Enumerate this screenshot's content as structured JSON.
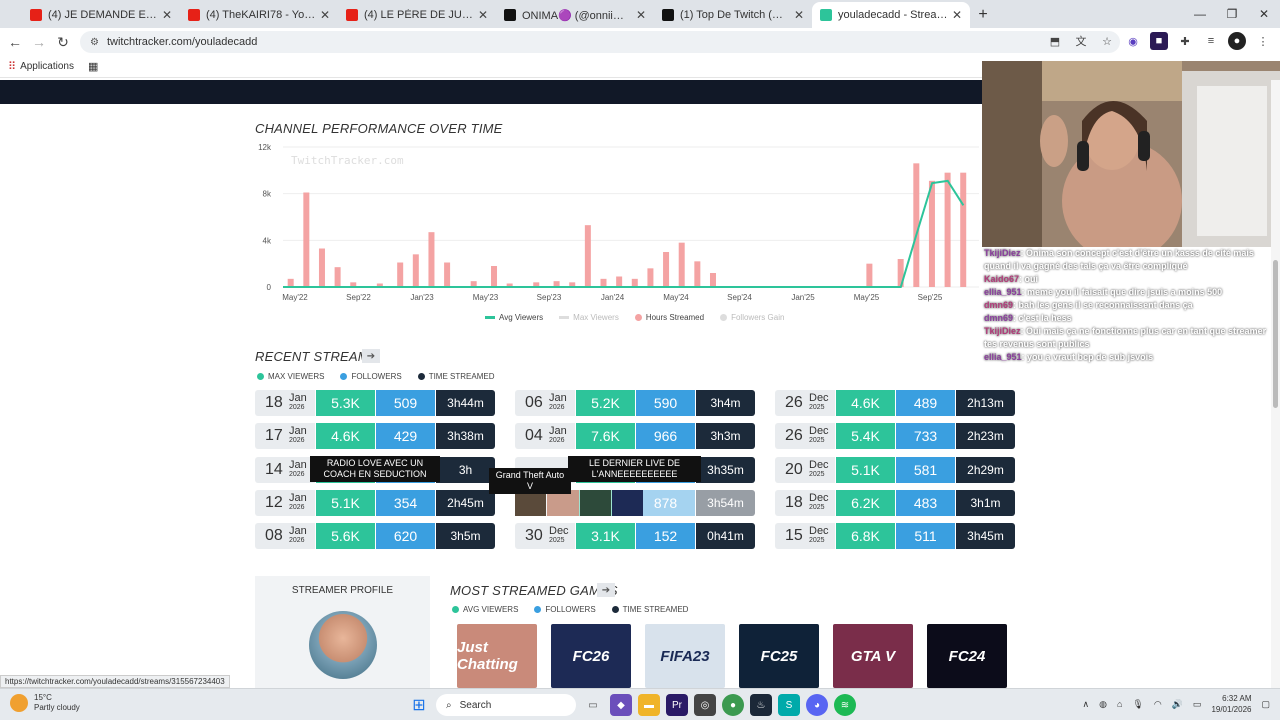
{
  "browser": {
    "tabs": [
      {
        "title": "(4) JE DEMANDE EN MARIAGE ...",
        "fav_color": "#e62117",
        "active": false
      },
      {
        "title": "(4) TheKAIRI78 - YouTube",
        "fav_color": "#e62117",
        "active": false
      },
      {
        "title": "(4) LE PÈRE DE JULIE TÉMOIGN...",
        "fav_color": "#e62117",
        "active": false
      },
      {
        "title": "ONIMA🟣 (@onniimmaa) | Tik...",
        "fav_color": "#111111",
        "active": false
      },
      {
        "title": "(1) Top De Twitch (@TopDeTwit...",
        "fav_color": "#111111",
        "active": false
      },
      {
        "title": "youladecadd - Streamer Overv...",
        "fav_color": "#2dc49a",
        "active": true
      }
    ],
    "url": "twitchtracker.com/youladecadd",
    "bookmarks_label": "Applications",
    "status_link": "https://twitchtracker.com/youladecadd/streams/315567234403"
  },
  "performance": {
    "title": "CHANNEL PERFORMANCE OVER TIME",
    "watermark": "TwitchTracker.com",
    "legend": [
      "Avg Viewers",
      "Max Viewers",
      "Hours Streamed",
      "Followers Gain"
    ]
  },
  "chart_data": {
    "type": "bar",
    "title": "CHANNEL PERFORMANCE OVER TIME",
    "x_ticks": [
      "May'22",
      "Sep'22",
      "Jan'23",
      "May'23",
      "Sep'23",
      "Jan'24",
      "May'24",
      "Sep'24",
      "Jan'25",
      "May'25",
      "Sep'25"
    ],
    "y_ticks": [
      "0",
      "4k",
      "8k",
      "12k"
    ],
    "ylim": [
      0,
      12000
    ],
    "series": [
      {
        "name": "Hours Streamed",
        "color": "#f4a3a3",
        "kind": "bar",
        "points": [
          [
            0.3,
            700
          ],
          [
            1.3,
            8100
          ],
          [
            2.3,
            3300
          ],
          [
            3.3,
            1700
          ],
          [
            4.3,
            400
          ],
          [
            6,
            300
          ],
          [
            7.3,
            2100
          ],
          [
            8.3,
            2800
          ],
          [
            9.3,
            4700
          ],
          [
            10.3,
            2100
          ],
          [
            12,
            500
          ],
          [
            13.3,
            1800
          ],
          [
            14.3,
            300
          ],
          [
            16,
            400
          ],
          [
            17.3,
            500
          ],
          [
            18.3,
            400
          ],
          [
            19.3,
            5300
          ],
          [
            20.3,
            700
          ],
          [
            21.3,
            900
          ],
          [
            22.3,
            700
          ],
          [
            23.3,
            1600
          ],
          [
            24.3,
            3000
          ],
          [
            25.3,
            3800
          ],
          [
            26.3,
            2200
          ],
          [
            27.3,
            1200
          ],
          [
            37.3,
            2000
          ],
          [
            39.3,
            2400
          ],
          [
            40.3,
            10600
          ],
          [
            41.3,
            9100
          ],
          [
            42.3,
            9800
          ],
          [
            43.3,
            9800
          ]
        ]
      },
      {
        "name": "Avg Viewers",
        "color": "#2dc49a",
        "kind": "line",
        "points": [
          [
            0,
            0
          ],
          [
            39.5,
            0
          ],
          [
            40.5,
            4500
          ],
          [
            41.5,
            8900
          ],
          [
            42.5,
            9100
          ],
          [
            43.5,
            7000
          ]
        ]
      }
    ]
  },
  "recent": {
    "title": "RECENT STREAMS",
    "legend": [
      "MAX VIEWERS",
      "FOLLOWERS",
      "TIME STREAMED"
    ],
    "col1": [
      {
        "day": "18",
        "mon": "Jan",
        "yr": "2026",
        "max": "5.3K",
        "fol": "509",
        "time": "3h44m"
      },
      {
        "day": "17",
        "mon": "Jan",
        "yr": "2026",
        "max": "4.6K",
        "fol": "429",
        "time": "3h38m"
      },
      {
        "day": "14",
        "mon": "Jan",
        "yr": "2026",
        "max": "",
        "fol": "",
        "time": "3h"
      },
      {
        "day": "12",
        "mon": "Jan",
        "yr": "2026",
        "max": "5.1K",
        "fol": "354",
        "time": "2h45m"
      },
      {
        "day": "08",
        "mon": "Jan",
        "yr": "2026",
        "max": "5.6K",
        "fol": "620",
        "time": "3h5m"
      }
    ],
    "col2": [
      {
        "day": "06",
        "mon": "Jan",
        "yr": "2026",
        "max": "5.2K",
        "fol": "590",
        "time": "3h4m"
      },
      {
        "day": "04",
        "mon": "Jan",
        "yr": "2026",
        "max": "7.6K",
        "fol": "966",
        "time": "3h3m"
      },
      {
        "day": "",
        "mon": "",
        "yr": "",
        "max": "",
        "fol": "",
        "time": "3h35m"
      },
      {
        "day": "",
        "mon": "",
        "yr": "",
        "max": "",
        "fol": "878",
        "time": "3h54m"
      },
      {
        "day": "30",
        "mon": "Dec",
        "yr": "2025",
        "max": "3.1K",
        "fol": "152",
        "time": "0h41m"
      }
    ],
    "col3": [
      {
        "day": "26",
        "mon": "Dec",
        "yr": "2025",
        "max": "4.6K",
        "fol": "489",
        "time": "2h13m"
      },
      {
        "day": "26",
        "mon": "Dec",
        "yr": "2025",
        "max": "5.4K",
        "fol": "733",
        "time": "2h23m"
      },
      {
        "day": "20",
        "mon": "Dec",
        "yr": "2025",
        "max": "5.1K",
        "fol": "581",
        "time": "2h29m"
      },
      {
        "day": "18",
        "mon": "Dec",
        "yr": "2025",
        "max": "6.2K",
        "fol": "483",
        "time": "3h1m"
      },
      {
        "day": "15",
        "mon": "Dec",
        "yr": "2025",
        "max": "6.8K",
        "fol": "511",
        "time": "3h45m"
      }
    ],
    "tooltip1": "RADIO LOVE AVEC UN COACH EN SEDUCTION",
    "tooltip2": "Grand Theft Auto V",
    "tooltip3": "LE DERNIER LIVE DE L'ANNEEEEEEEEEE"
  },
  "profile": {
    "title": "STREAMER PROFILE"
  },
  "games": {
    "title": "MOST STREAMED GAMES",
    "legend": [
      "AVG VIEWERS",
      "FOLLOWERS",
      "TIME STREAMED"
    ],
    "items": [
      {
        "name": "Just Chatting",
        "bg": "#c98a7a"
      },
      {
        "name": "FC26",
        "bg": "#1d2a55"
      },
      {
        "name": "FIFA23",
        "bg": "#d8e2ec"
      },
      {
        "name": "FC25",
        "bg": "#0f2238"
      },
      {
        "name": "GTA V",
        "bg": "#7a2d4a"
      },
      {
        "name": "FC24",
        "bg": "#0c0c1a"
      }
    ]
  },
  "chat": [
    {
      "user": "TkijiDiez",
      "msg": ": Onima son concept c'est d'être un kasss de cité mais quand il va gagné des tals ça va être compliqué"
    },
    {
      "user": "Kaido67",
      "msg": ": oui"
    },
    {
      "user": "ellia_951",
      "msg": ": meme you il faisait que dire jsuis a moins 500"
    },
    {
      "user": "dmn69",
      "msg": ": bah les gens il se reconnaissent dans ça"
    },
    {
      "user": "dmn69",
      "msg": ": c'est la hess"
    },
    {
      "user": "TkijiDiez",
      "msg": ": Oui mais ça ne fonctionne plus car en tant que streamer tes revenus sont publics"
    },
    {
      "user": "ellia_951",
      "msg": ": you a vraut bcp de sub jsvois"
    }
  ],
  "taskbar": {
    "temp": "15°C",
    "weather": "Partly cloudy",
    "search": "Search",
    "time": "6:32 AM",
    "date": "19/01/2026"
  }
}
